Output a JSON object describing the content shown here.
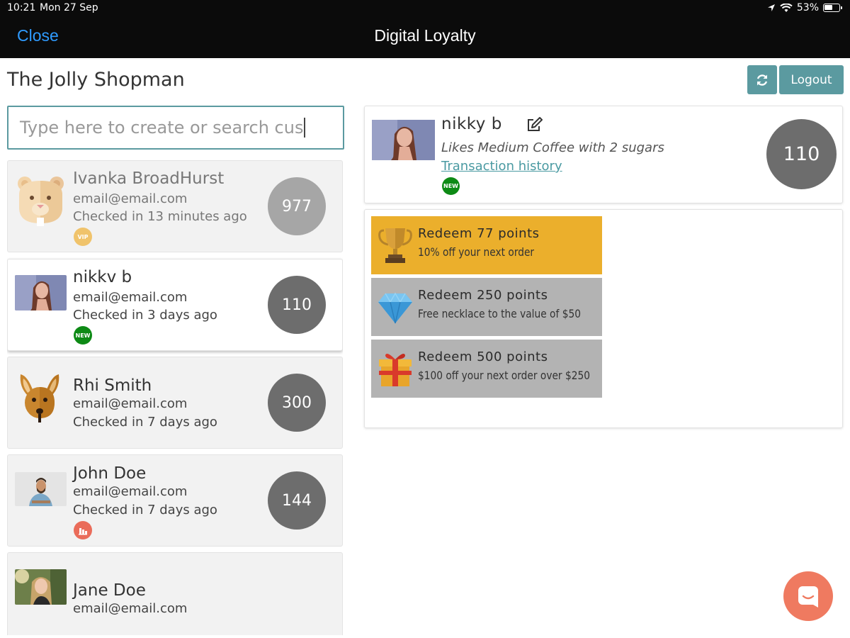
{
  "status_bar": {
    "time": "10:21",
    "date": "Mon 27 Sep",
    "battery": "53%"
  },
  "nav": {
    "close_label": "Close",
    "title": "Digital Loyalty"
  },
  "shop": {
    "name": "The Jolly Shopman"
  },
  "header_actions": {
    "logout_label": "Logout",
    "refresh_icon": "refresh-icon"
  },
  "search": {
    "placeholder": "Type here to create or search cus"
  },
  "customers": [
    {
      "name": "Ivanka BroadHurst",
      "email": "email@email.com",
      "checked": "Checked in 13 minutes ago",
      "points": "977",
      "badge": "VIP",
      "avatar": "bear-avatar"
    },
    {
      "name": "nikkv b",
      "email": "email@email.com",
      "checked": "Checked in 3 days ago",
      "points": "110",
      "badge": "NEW",
      "avatar": "photo-woman"
    },
    {
      "name": "Rhi Smith",
      "email": "email@email.com",
      "checked": "Checked in 7 days ago",
      "points": "300",
      "badge": "",
      "avatar": "kangaroo-avatar"
    },
    {
      "name": "John Doe",
      "email": "email@email.com",
      "checked": "Checked in 7 days ago",
      "points": "144",
      "badge": "chart-icon",
      "avatar": "photo-man"
    },
    {
      "name": "Jane Doe",
      "email": "email@email.com",
      "checked": "",
      "points": "",
      "badge": "",
      "avatar": "photo-woman-2"
    }
  ],
  "selected_customer": {
    "name": "nikky b",
    "note": "Likes Medium Coffee with 2 sugars",
    "history_link": "Transaction history",
    "badge": "NEW",
    "points": "110"
  },
  "rewards": [
    {
      "title": "Redeem 77 points",
      "description": "10% off your next order",
      "icon": "trophy-icon",
      "state": "available"
    },
    {
      "title": "Redeem 250 points",
      "description": "Free necklace to the value of $50",
      "icon": "diamond-icon",
      "state": "unavailable"
    },
    {
      "title": "Redeem 500 points",
      "description": "$100 off your next order over $250",
      "icon": "gift-icon",
      "state": "unavailable"
    }
  ],
  "colors": {
    "accent": "#5b9aa0",
    "nav_link": "#2f9bff",
    "reward_active": "#ebaf2c",
    "reward_inactive": "#b3b3b3",
    "chat": "#ef7a60",
    "badge_new": "#0d8a15"
  }
}
